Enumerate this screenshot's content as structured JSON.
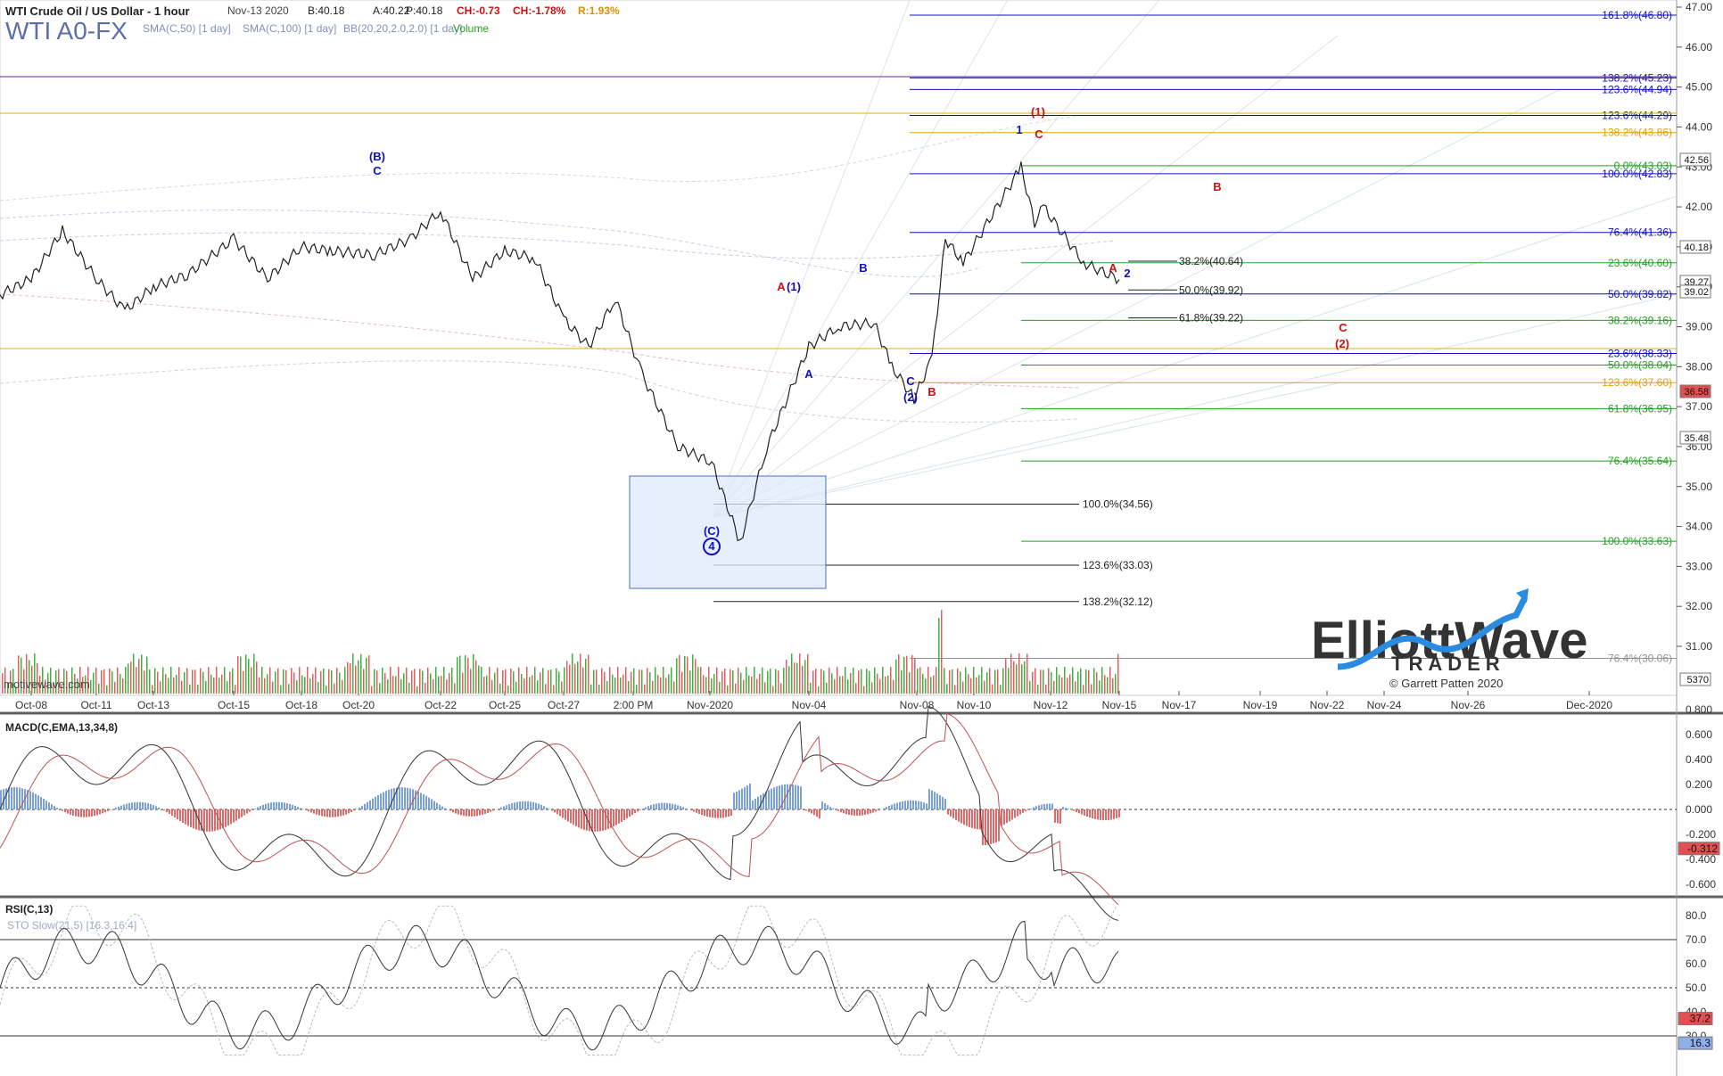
{
  "header": {
    "title": "WTI Crude Oil / US Dollar - 1 hour",
    "date": "Nov-13 2020",
    "bid": "B:40.18",
    "ask": "A:40.22",
    "price": "P:40.18",
    "change": "CH:-0.73",
    "change_pct": "CH:-1.78%",
    "range": "R:1.93%",
    "symbol": "WTI A0-FX",
    "studies": [
      "SMA(C,50) [1 day]",
      "SMA(C,100) [1 day]",
      "BB(20,20,2.0,2.0) [1 day]",
      "Volume"
    ],
    "watermark": "motivewave.com"
  },
  "colors": {
    "blue": "#1010c0",
    "red": "#d01010",
    "green": "#20a020",
    "gold": "#e0b000",
    "purple": "#6a2aa0"
  },
  "chart_data": [
    {
      "type": "line",
      "title": "WTI Crude Oil / US Dollar - 1 hour",
      "x_labels": [
        "Oct-08",
        "Oct-11",
        "Oct-13",
        "Oct-15",
        "Oct-18",
        "Oct-20",
        "Oct-22",
        "Oct-25",
        "Oct-27",
        "2:00 PM",
        "Nov-2020",
        "Nov-04",
        "Nov-08",
        "Nov-10",
        "Nov-12",
        "Nov-15",
        "Nov-17",
        "Nov-19",
        "Nov-22",
        "Nov-24",
        "Nov-26",
        "Dec-2020"
      ],
      "y_ticks": [
        "47.00",
        "46.00",
        "45.00",
        "44.00",
        "43.00",
        "42.00",
        "41.00",
        "40.00",
        "39.00",
        "38.00",
        "37.00",
        "36.00",
        "35.00",
        "34.00",
        "33.00",
        "32.00",
        "31.00"
      ],
      "ylim": [
        30.5,
        47.2
      ],
      "price_path": [
        {
          "x": "Oct-07",
          "y": 39.8
        },
        {
          "x": "Oct-08",
          "y": 40.2
        },
        {
          "x": "Oct-09",
          "y": 41.4
        },
        {
          "x": "Oct-11",
          "y": 40.2
        },
        {
          "x": "Oct-12",
          "y": 39.4
        },
        {
          "x": "Oct-13",
          "y": 40.0
        },
        {
          "x": "Oct-14",
          "y": 40.3
        },
        {
          "x": "Oct-15",
          "y": 41.2
        },
        {
          "x": "Oct-16",
          "y": 40.2
        },
        {
          "x": "Oct-17",
          "y": 41.0
        },
        {
          "x": "Oct-18",
          "y": 40.9
        },
        {
          "x": "Oct-19",
          "y": 40.8
        },
        {
          "x": "Oct-20",
          "y": 41.2
        },
        {
          "x": "Oct-21",
          "y": 41.9
        },
        {
          "x": "Oct-22",
          "y": 40.2
        },
        {
          "x": "Oct-23",
          "y": 40.9
        },
        {
          "x": "Oct-24",
          "y": 40.7
        },
        {
          "x": "Oct-25",
          "y": 39.2
        },
        {
          "x": "Oct-26",
          "y": 38.5
        },
        {
          "x": "Oct-27",
          "y": 39.7
        },
        {
          "x": "Oct-28",
          "y": 37.8
        },
        {
          "x": "Oct-29",
          "y": 36.0
        },
        {
          "x": "Oct-30",
          "y": 35.6
        },
        {
          "x": "Nov-01",
          "y": 33.6
        },
        {
          "x": "Nov-02",
          "y": 36.0
        },
        {
          "x": "Nov-03",
          "y": 38.5
        },
        {
          "x": "Nov-04",
          "y": 39.0
        },
        {
          "x": "Nov-05",
          "y": 39.1
        },
        {
          "x": "Nov-06",
          "y": 38.0
        },
        {
          "x": "Nov-07",
          "y": 37.2
        },
        {
          "x": "Nov-08",
          "y": 38.2
        },
        {
          "x": "Nov-09",
          "y": 41.2
        },
        {
          "x": "Nov-10",
          "y": 40.6
        },
        {
          "x": "Nov-11",
          "y": 43.0
        },
        {
          "x": "Nov-11b",
          "y": 41.6
        },
        {
          "x": "Nov-12",
          "y": 42.0
        },
        {
          "x": "Nov-12b",
          "y": 40.6
        },
        {
          "x": "Nov-13",
          "y": 40.18
        }
      ],
      "price_badges": [
        {
          "value": "42.56",
          "color": "#ffffff"
        },
        {
          "value": "40.18",
          "color": "#ffffff"
        },
        {
          "value": "39.27",
          "color": "#ffffff"
        },
        {
          "value": "39.02",
          "color": "#ffffff"
        },
        {
          "value": "36.58",
          "color": "#e05050"
        },
        {
          "value": "35.48",
          "color": "#ffffff"
        },
        {
          "value": "5370",
          "color": "#ffffff"
        }
      ],
      "fib_levels_right": [
        {
          "label": "161.8%(46.80)",
          "y": 46.8,
          "color": "#1010c0"
        },
        {
          "label": "138.2%(45.23)",
          "y": 45.23,
          "color": "#1010c0"
        },
        {
          "label": "123.6%(44.94)",
          "y": 44.94,
          "color": "#1010c0"
        },
        {
          "label": "123.6%(44.29)",
          "y": 44.29,
          "color": "#1010c0"
        },
        {
          "label": "138.2%(43.86)",
          "y": 43.86,
          "color": "#e0a000"
        },
        {
          "label": "0.0%(43.03)",
          "y": 43.03,
          "color": "#20a020"
        },
        {
          "label": "100.0%(42.83)",
          "y": 42.83,
          "color": "#1010c0"
        },
        {
          "label": "76.4%(41.36)",
          "y": 41.36,
          "color": "#1010c0"
        },
        {
          "label": "23.6%(40.60)",
          "y": 40.6,
          "color": "#20a020"
        },
        {
          "label": "50.0%(39.82)",
          "y": 39.82,
          "color": "#1010c0"
        },
        {
          "label": "38.2%(39.16)",
          "y": 39.16,
          "color": "#20a020"
        },
        {
          "label": "23.6%(38.33)",
          "y": 38.33,
          "color": "#1010c0"
        },
        {
          "label": "50.0%(38.04)",
          "y": 38.04,
          "color": "#20a020"
        },
        {
          "label": "123.6%(37.60)",
          "y": 37.6,
          "color": "#e0a000"
        },
        {
          "label": "61.8%(36.95)",
          "y": 36.95,
          "color": "#20a020"
        },
        {
          "label": "76.4%(35.64)",
          "y": 35.64,
          "color": "#20a020"
        },
        {
          "label": "100.0%(33.63)",
          "y": 33.63,
          "color": "#20a020"
        },
        {
          "label": "76.4%(30.06)",
          "y": 30.7,
          "color": "#909090"
        }
      ],
      "fib_levels_mid": [
        {
          "label": "38.2%(40.64)",
          "y": 40.64
        },
        {
          "label": "50.0%(39.92)",
          "y": 39.92
        },
        {
          "label": "61.8%(39.22)",
          "y": 39.22
        }
      ],
      "fib_levels_left": [
        {
          "label": "100.0%(34.56)",
          "y": 34.56
        },
        {
          "label": "123.6%(33.03)",
          "y": 33.03
        },
        {
          "label": "138.2%(32.12)",
          "y": 32.12
        }
      ],
      "wave_labels": [
        {
          "text": "(B)",
          "color": "#1010c0"
        },
        {
          "text": "C",
          "color": "#1010c0"
        },
        {
          "text": "A",
          "color": "#d01010"
        },
        {
          "text": "(1)",
          "color": "#1010c0"
        },
        {
          "text": "B",
          "color": "#1010c0"
        },
        {
          "text": "A",
          "color": "#1010c0"
        },
        {
          "text": "C",
          "color": "#1010c0"
        },
        {
          "text": "(2)",
          "color": "#1010c0"
        },
        {
          "text": "B",
          "color": "#d01010"
        },
        {
          "text": "(C)",
          "color": "#1010c0"
        },
        {
          "text": "4",
          "color": "#1010c0"
        },
        {
          "text": "(1)",
          "color": "#d01010"
        },
        {
          "text": "1",
          "color": "#1010c0"
        },
        {
          "text": "C",
          "color": "#d01010"
        },
        {
          "text": "B",
          "color": "#d01010"
        },
        {
          "text": "A",
          "color": "#d01010"
        },
        {
          "text": "2",
          "color": "#1010c0"
        },
        {
          "text": "C",
          "color": "#d01010"
        },
        {
          "text": "(2)",
          "color": "#d01010"
        }
      ]
    },
    {
      "type": "line",
      "title": "MACD(C,EMA,13,34,8)",
      "y_ticks": [
        "0.800",
        "0.600",
        "0.400",
        "0.200",
        "0.000",
        "-0.200",
        "-0.400",
        "-0.600"
      ],
      "ylim": [
        -0.8,
        0.9
      ],
      "last_value": "-0.312"
    },
    {
      "type": "line",
      "title": "RSI(C,13)",
      "subtitle": "STO Slow(21,5) [16.3,16.4]",
      "y_ticks": [
        "80.0",
        "70.0",
        "60.0",
        "50.0",
        "40.0",
        "30.0"
      ],
      "ylim": [
        22,
        86
      ],
      "last_value": "37.2",
      "sto_value": "16.3"
    }
  ],
  "logo": {
    "line1": "ElliottWave",
    "line2": "TRADER",
    "copyright": "© Garrett Patten 2020"
  }
}
